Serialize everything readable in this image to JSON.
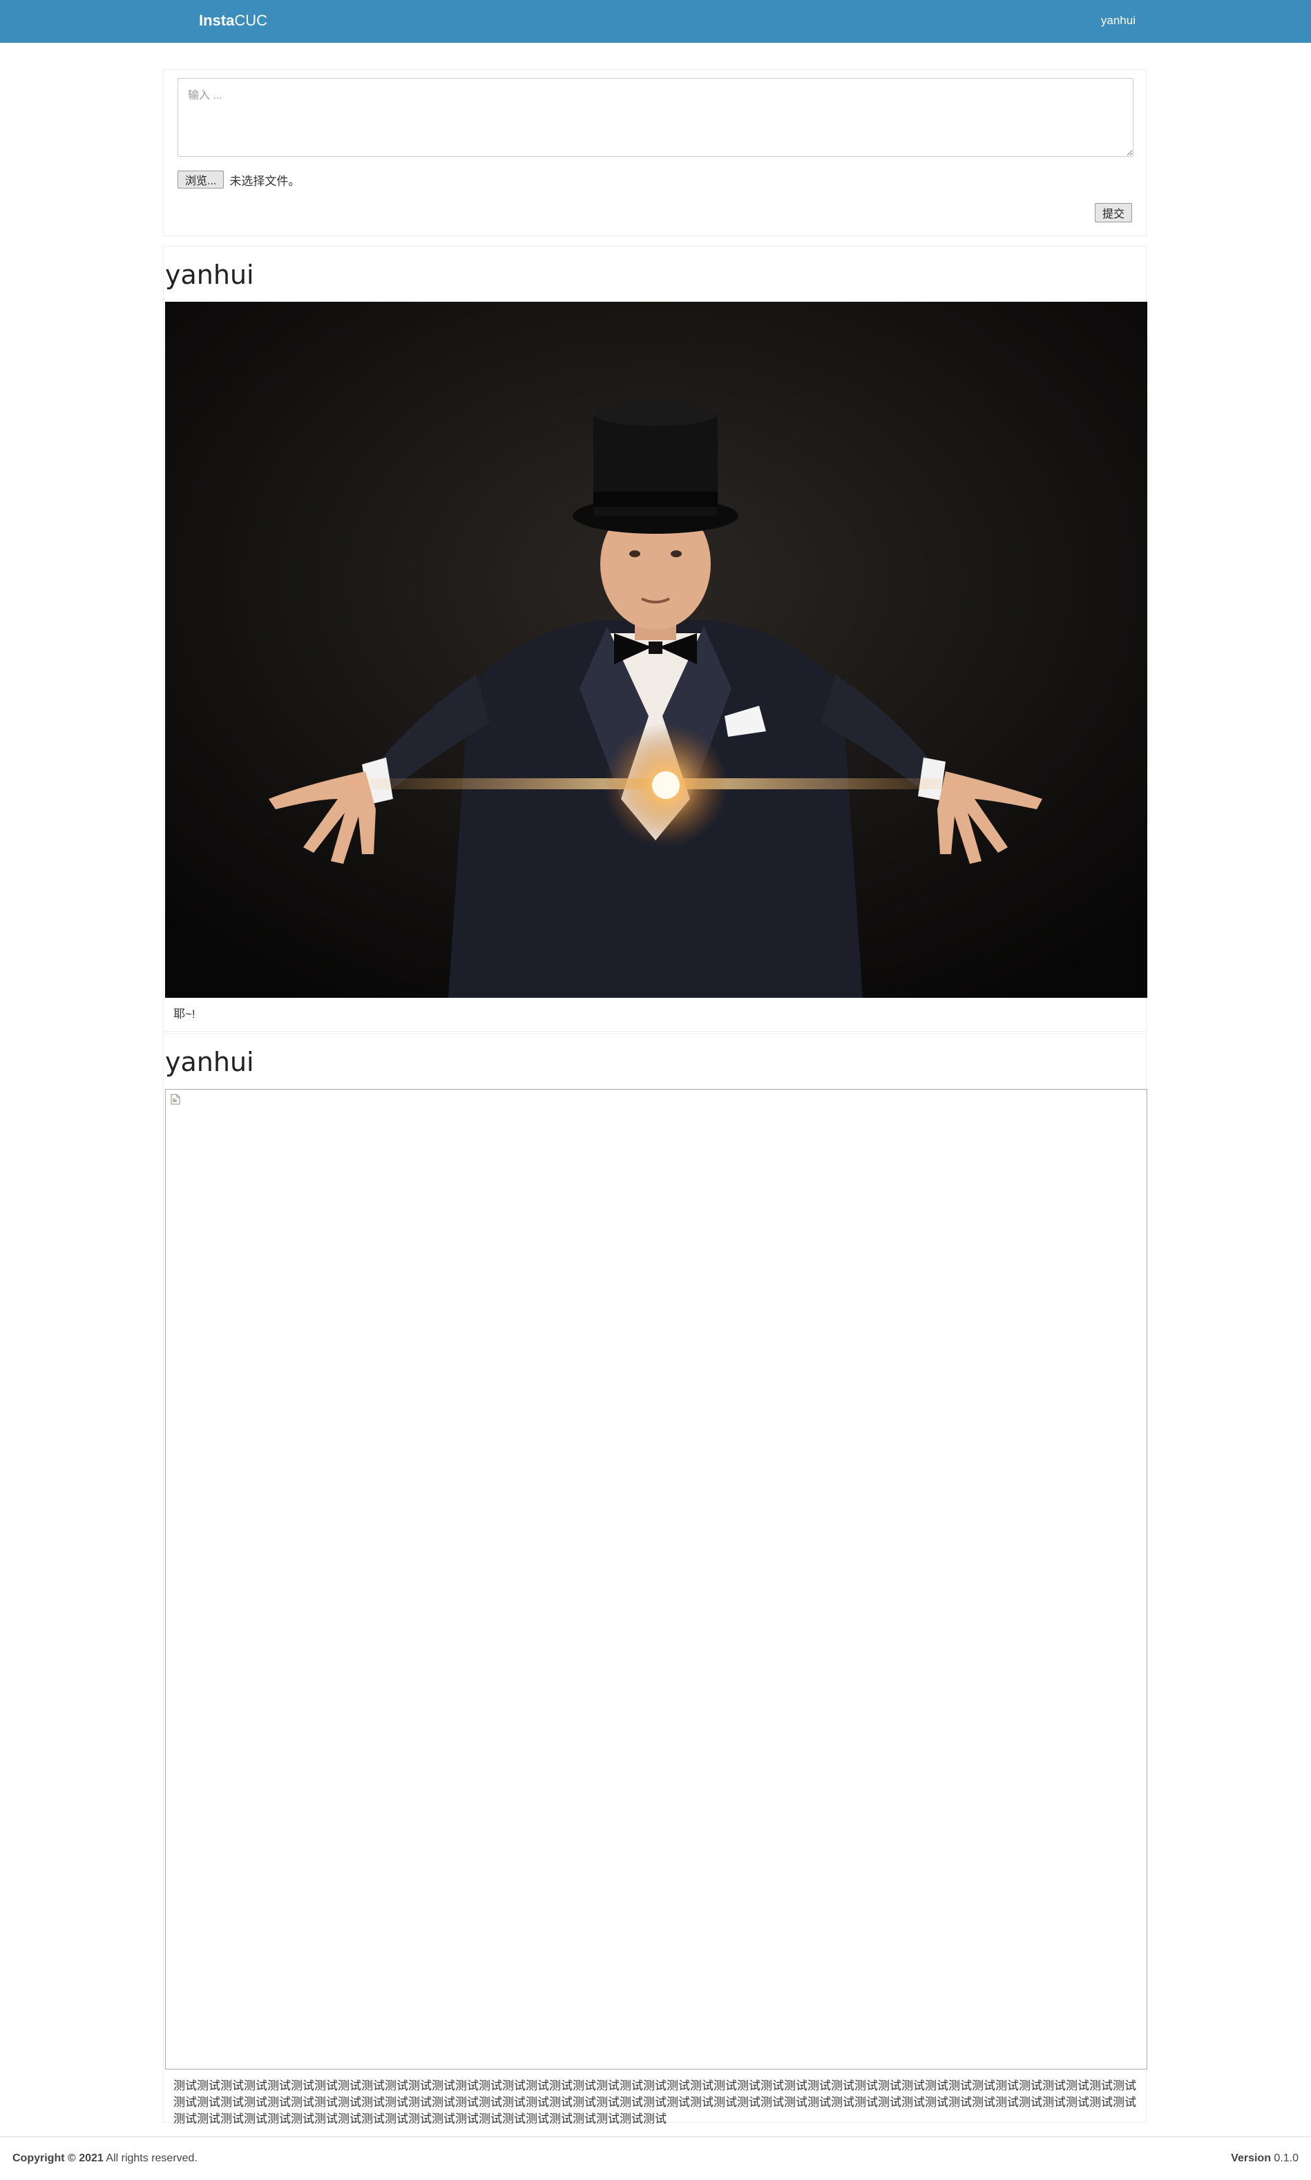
{
  "navbar": {
    "brand_bold": "Insta",
    "brand_rest": "CUC",
    "user": "yanhui"
  },
  "composer": {
    "placeholder": "输入 ...",
    "browse_label": "浏览...",
    "file_status": "未选择文件。",
    "submit_label": "提交"
  },
  "posts": [
    {
      "author": "yanhui",
      "image": "magician-photo",
      "caption": "耶~!"
    },
    {
      "author": "yanhui",
      "image": "broken-image-icon",
      "caption": "测试测试测试测试测试测试测试测试测试测试测试测试测试测试测试测试测试测试测试测试测试测试测试测试测试测试测试测试测试测试测试测试测试测试测试测试测试测试测试测试测试测试测试测试测试测试测试测试测试测试测试测试测试测试测试测试测试测试测试测试测试测试测试测试测试测试测试测试测试测试测试测试测试测试测试测试测试测试测试测试测试测试测试测试测试测试测试测试测试测试测试测试测试测试测试测试测试测试测试测试测试测试测试"
    }
  ],
  "footer": {
    "copyright_bold": "Copyright © 2021",
    "copyright_rest": " All rights reserved.",
    "version_bold": "Version",
    "version_rest": " 0.1.0"
  }
}
